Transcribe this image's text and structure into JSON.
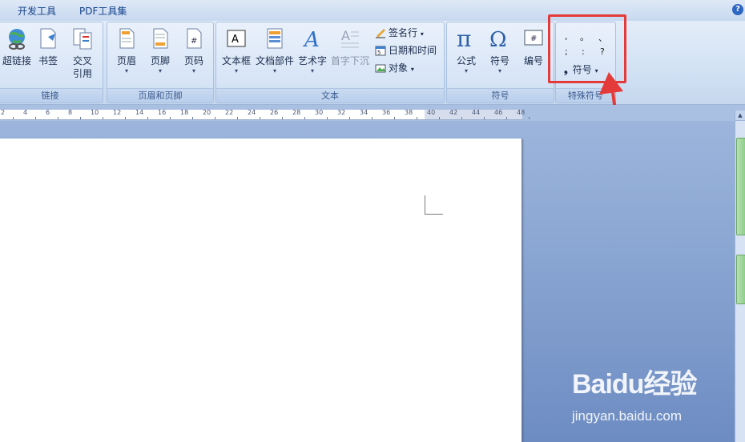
{
  "menu": {
    "tabs": [
      "开发工具",
      "PDF工具集"
    ],
    "help": "?"
  },
  "ribbon": {
    "links": {
      "label": "链接",
      "buttons": [
        "超链接",
        "书签",
        "交叉\n引用"
      ]
    },
    "header_footer": {
      "label": "页眉和页脚",
      "buttons": [
        "页眉",
        "页脚",
        "页码"
      ]
    },
    "text": {
      "label": "文本",
      "buttons": [
        "文本框",
        "文档部件",
        "艺术字",
        "首字下沉"
      ],
      "small": [
        "签名行",
        "日期和时间",
        "对象"
      ]
    },
    "symbols": {
      "label": "符号",
      "buttons": [
        "公式",
        "符号",
        "编号"
      ]
    },
    "special": {
      "label": "特殊符号",
      "chars": [
        ",",
        "。",
        "、",
        ";",
        ":",
        "?"
      ],
      "more_label": "符号"
    }
  },
  "ruler": {
    "labels": [
      "2",
      "4",
      "6",
      "8",
      "10",
      "12",
      "14",
      "16",
      "18",
      "20",
      "22",
      "24",
      "26",
      "28",
      "30",
      "32",
      "34",
      "36",
      "38",
      "40",
      "42",
      "44",
      "46",
      "48"
    ]
  },
  "watermark": {
    "logo": "Baidu经验",
    "url": "jingyan.baidu.com"
  },
  "colors": {
    "highlight": "#e53a3a",
    "accent": "#15428b"
  }
}
